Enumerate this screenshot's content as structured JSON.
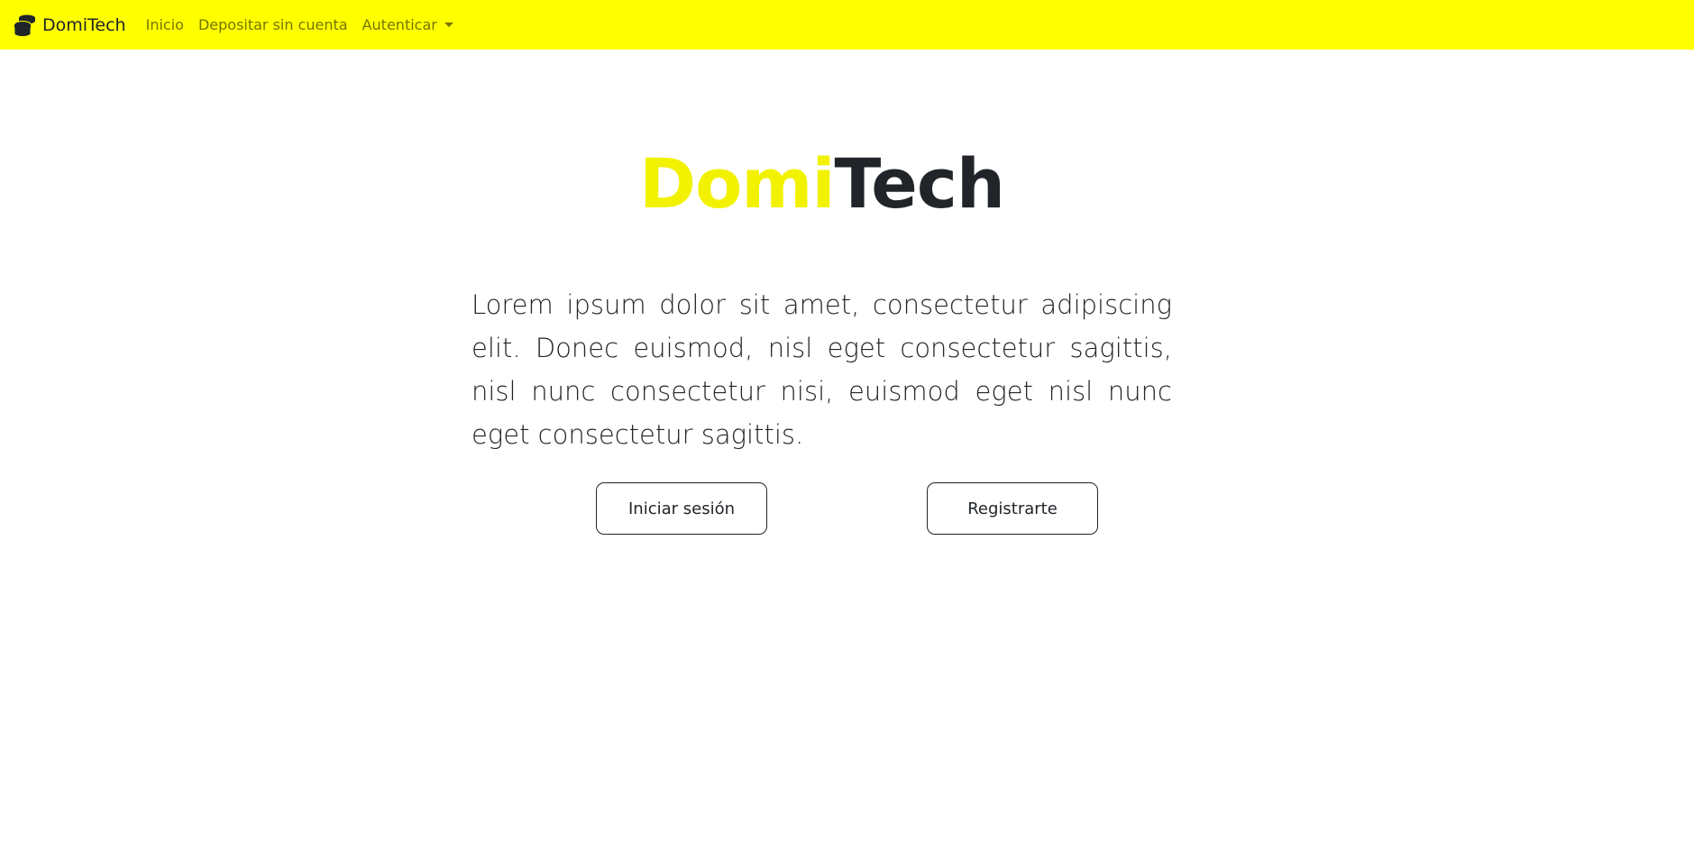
{
  "navbar": {
    "brand_label": "DomiTech",
    "brand_icon": "coins-icon",
    "background_color": "#ffff00",
    "links": [
      {
        "label": "Inicio"
      },
      {
        "label": "Depositar sin cuenta"
      },
      {
        "label": "Autenticar",
        "has_dropdown": true
      }
    ]
  },
  "hero": {
    "title_part_a": "Domi",
    "title_part_b": "Tech",
    "title_color_a": "#f2f200",
    "title_color_b": "#212529",
    "paragraph": "Lorem ipsum dolor sit amet, consectetur adipiscing elit. Donec euismod, nisl eget consectetur sagittis, nisl nunc consectetur nisi, euismod eget nisl nunc eget consectetur sagittis.",
    "buttons": {
      "login_label": "Iniciar sesión",
      "register_label": "Registrarte"
    }
  }
}
